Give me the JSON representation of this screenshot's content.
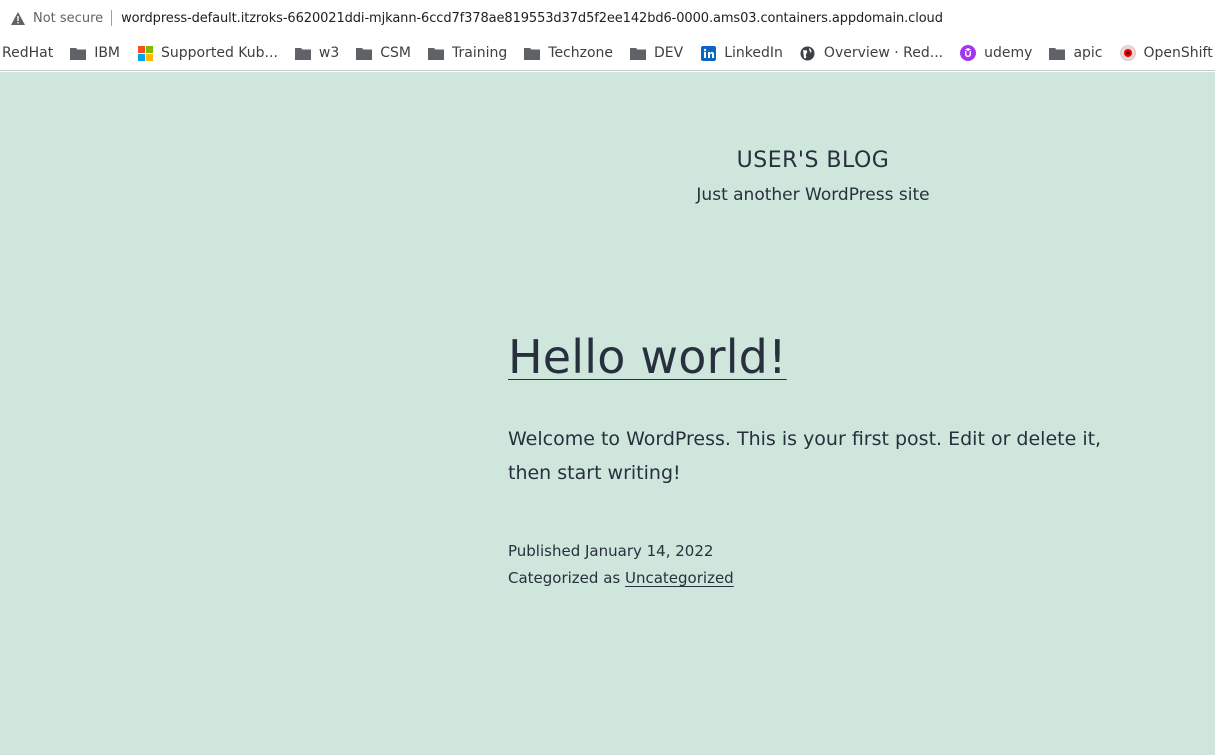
{
  "address_bar": {
    "security_label": "Not secure",
    "url": "wordpress-default.itzroks-6620021ddi-mjkann-6ccd7f378ae819553d37d5f2ee142bd6-0000.ams03.containers.appdomain.cloud",
    "security_icon": "warning-triangle-icon"
  },
  "bookmarks": [
    {
      "label": "RedHat",
      "icon": "none"
    },
    {
      "label": "IBM",
      "icon": "folder-icon"
    },
    {
      "label": "Supported Kub...",
      "icon": "microsoft-icon"
    },
    {
      "label": "w3",
      "icon": "folder-icon"
    },
    {
      "label": "CSM",
      "icon": "folder-icon"
    },
    {
      "label": "Training",
      "icon": "folder-icon"
    },
    {
      "label": "Techzone",
      "icon": "folder-icon"
    },
    {
      "label": "DEV",
      "icon": "folder-icon"
    },
    {
      "label": "LinkedIn",
      "icon": "linkedin-icon"
    },
    {
      "label": "Overview · Red...",
      "icon": "globe-icon"
    },
    {
      "label": "udemy",
      "icon": "udemy-icon"
    },
    {
      "label": "apic",
      "icon": "folder-icon"
    },
    {
      "label": "OpenShift Guides",
      "icon": "openshift-icon"
    }
  ],
  "site": {
    "title": "USER'S BLOG",
    "description": "Just another WordPress site",
    "background_color": "#cee6dc",
    "text_color": "#28303d"
  },
  "post": {
    "title": "Hello world!",
    "body": "Welcome to WordPress. This is your first post. Edit or delete it, then start writing!",
    "published_label": "Published",
    "published_date": "January 14, 2022",
    "categorized_label": "Categorized as",
    "category": "Uncategorized"
  }
}
